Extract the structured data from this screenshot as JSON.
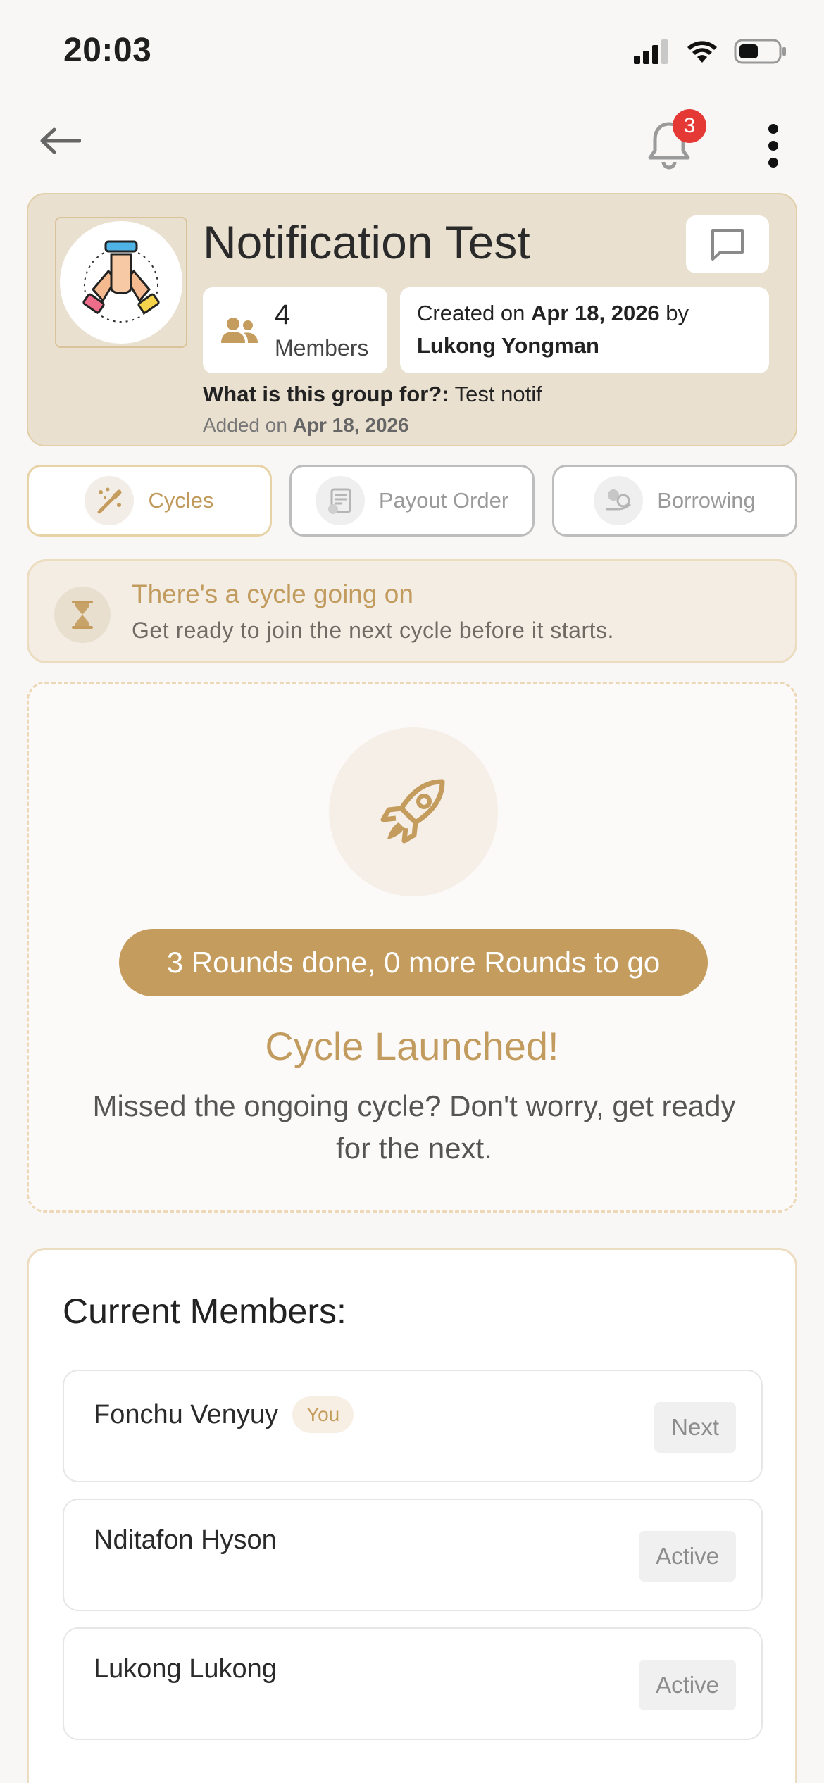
{
  "status_bar": {
    "time": "20:03"
  },
  "nav": {
    "notification_count": "3"
  },
  "group": {
    "title": "Notification Test",
    "members_count": "4",
    "members_label": "Members",
    "created_prefix": "Created on ",
    "created_date": "Apr 18, 2026",
    "created_by_word": " by",
    "creator": "Lukong Yongman",
    "purpose_label": "What is this group for?:",
    "purpose_value": " Test notif",
    "added_prefix": "Added on ",
    "added_date": "Apr 18, 2026"
  },
  "tabs": [
    {
      "label": "Cycles",
      "icon": "magic-wand-icon",
      "active": true
    },
    {
      "label": "Payout Order",
      "icon": "document-icon",
      "active": false
    },
    {
      "label": "Borrowing",
      "icon": "money-hand-icon",
      "active": false
    }
  ],
  "banner": {
    "title": "There's a cycle going on",
    "subtitle": "Get ready to join the next cycle before it starts.",
    "icon": "hourglass-icon"
  },
  "cycle": {
    "rounds_text": "3 Rounds done, 0 more Rounds to go",
    "title": "Cycle Launched!",
    "subtitle": "Missed the ongoing cycle? Don't worry, get ready for the next.",
    "icon": "rocket-icon"
  },
  "members_section": {
    "title": "Current Members:",
    "members": [
      {
        "name": "Fonchu Venyuy",
        "badge": "You",
        "status": "Next"
      },
      {
        "name": "Nditafon Hyson",
        "badge": "",
        "status": "Active"
      },
      {
        "name": "Lukong Lukong",
        "badge": "",
        "status": "Active"
      }
    ]
  },
  "colors": {
    "accent": "#c49c5d",
    "card_bg": "#e9e0d0",
    "badge_red": "#e53935"
  }
}
